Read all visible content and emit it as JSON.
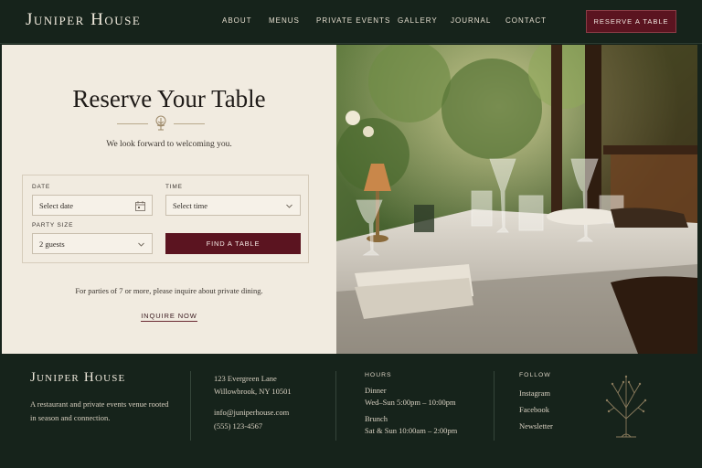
{
  "header": {
    "brand": "Juniper House",
    "nav": [
      "ABOUT",
      "MENUS",
      "PRIVATE EVENTS",
      "GALLERY",
      "JOURNAL",
      "CONTACT"
    ],
    "cta": "RESERVE A TABLE"
  },
  "reservation": {
    "title": "Reserve Your Table",
    "subtitle": "We look forward to welcoming you.",
    "date_label": "DATE",
    "date_value": "Select date",
    "time_label": "TIME",
    "time_value": "Select time",
    "party_label": "PARTY SIZE",
    "party_value": "2 guests",
    "submit": "FIND A TABLE",
    "note": "For parties of 7 or more, please inquire about private dining.",
    "inquire": "INQUIRE NOW"
  },
  "footer": {
    "brand": "Juniper House",
    "tagline": "A restaurant and private events venue rooted in season and connection.",
    "address_line1": "123 Evergreen Lane",
    "address_line2": "Willowbrook, NY 10501",
    "email": "info@juniperhouse.com",
    "phone": "(555) 123-4567",
    "hours_heading": "HOURS",
    "dinner_label": "Dinner",
    "dinner_hours": "Wed–Sun 5:00pm – 10:00pm",
    "brunch_label": "Brunch",
    "brunch_hours": "Sat & Sun 10:00am – 2:00pm",
    "follow_heading": "FOLLOW",
    "social": [
      "Instagram",
      "Facebook",
      "Newsletter"
    ]
  },
  "icons": {
    "calendar": "calendar-icon",
    "chevron": "chevron-down-icon",
    "ornament": "tree-ornament-icon",
    "footer_tree": "tree-emblem-icon"
  },
  "colors": {
    "forest": "#16231b",
    "cream": "#f1ebe0",
    "wine": "#5b1420"
  }
}
